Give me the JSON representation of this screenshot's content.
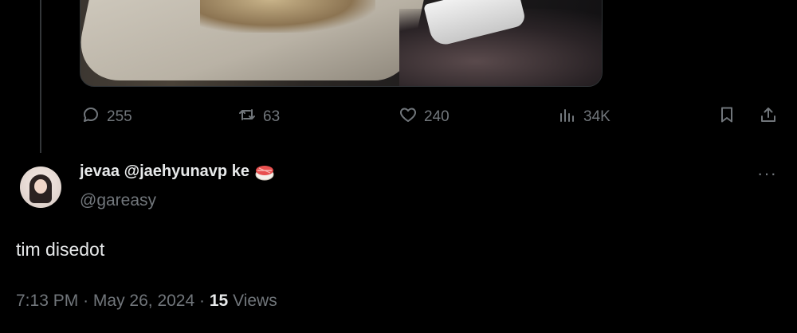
{
  "actions": {
    "reply_count": "255",
    "repost_count": "63",
    "like_count": "240",
    "views_count": "34K"
  },
  "reply": {
    "display_name": "jevaa @jaehyunavp ke",
    "handle": "@gareasy",
    "more": "···",
    "text": "tim disedot",
    "time": "7:13 PM",
    "separator": "·",
    "date": "May 26, 2024",
    "views": "15",
    "views_label": "Views"
  },
  "icons": {
    "reply": "speech-bubble-icon",
    "repost": "repost-icon",
    "like": "heart-icon",
    "views": "bar-chart-icon",
    "bookmark": "bookmark-icon",
    "share": "share-icon",
    "emoji": "sushi-emoji-icon"
  },
  "colors": {
    "background": "#000000",
    "text": "#e7e9ea",
    "muted": "#71767b"
  }
}
